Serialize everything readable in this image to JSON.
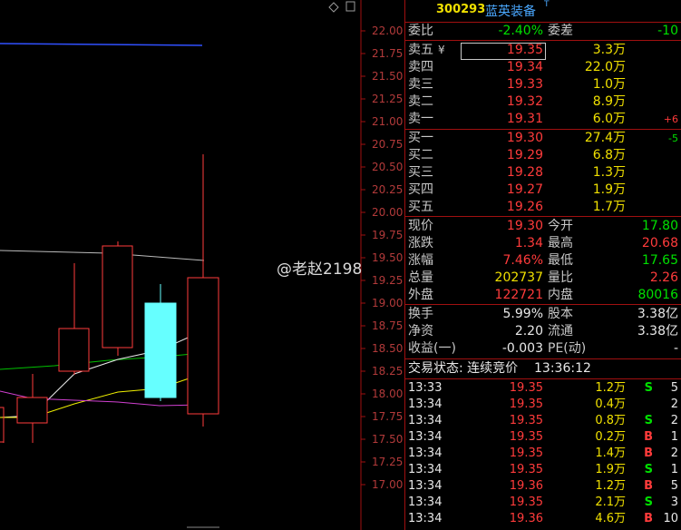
{
  "chart": {
    "price_ticks": [
      "22.00",
      "21.75",
      "21.50",
      "21.25",
      "21.00",
      "20.75",
      "20.50",
      "20.25",
      "20.00",
      "19.75",
      "19.50",
      "19.25",
      "19.00",
      "18.75",
      "18.50",
      "18.25",
      "18.00",
      "17.75",
      "17.50",
      "17.25",
      "17.00"
    ],
    "corner_icon": "diamond-icon"
  },
  "watermark": "@老赵2198",
  "header": {
    "code": "300293",
    "name": "蓝英装备",
    "mark": "T"
  },
  "weibi": {
    "label": "委比",
    "value": "-2.40%",
    "label2": "委差",
    "value2": "-10"
  },
  "sell": [
    {
      "label": "卖五",
      "tag": "¥",
      "price": "19.35",
      "vol": "3.3万",
      "chg": ""
    },
    {
      "label": "卖四",
      "tag": "",
      "price": "19.34",
      "vol": "22.0万",
      "chg": ""
    },
    {
      "label": "卖三",
      "tag": "",
      "price": "19.33",
      "vol": "1.0万",
      "chg": ""
    },
    {
      "label": "卖二",
      "tag": "",
      "price": "19.32",
      "vol": "8.9万",
      "chg": ""
    },
    {
      "label": "卖一",
      "tag": "",
      "price": "19.31",
      "vol": "6.0万",
      "chg": "+6"
    }
  ],
  "buy": [
    {
      "label": "买一",
      "price": "19.30",
      "vol": "27.4万",
      "chg": "-5"
    },
    {
      "label": "买二",
      "price": "19.29",
      "vol": "6.8万",
      "chg": ""
    },
    {
      "label": "买三",
      "price": "19.28",
      "vol": "1.3万",
      "chg": ""
    },
    {
      "label": "买四",
      "price": "19.27",
      "vol": "1.9万",
      "chg": ""
    },
    {
      "label": "买五",
      "price": "19.26",
      "vol": "1.7万",
      "chg": ""
    }
  ],
  "quote": [
    {
      "l1": "现价",
      "v1": "19.30",
      "c1": "red",
      "l2": "今开",
      "v2": "17.80",
      "c2": "grn"
    },
    {
      "l1": "涨跌",
      "v1": "1.34",
      "c1": "red",
      "l2": "最高",
      "v2": "20.68",
      "c2": "red"
    },
    {
      "l1": "涨幅",
      "v1": "7.46%",
      "c1": "red",
      "l2": "最低",
      "v2": "17.65",
      "c2": "grn"
    },
    {
      "l1": "总量",
      "v1": "202737",
      "c1": "yel",
      "l2": "量比",
      "v2": "2.26",
      "c2": "red"
    },
    {
      "l1": "外盘",
      "v1": "122721",
      "c1": "red",
      "l2": "内盘",
      "v2": "80016",
      "c2": "grn"
    }
  ],
  "info": [
    {
      "l1": "换手",
      "v1": "5.99%",
      "l2": "股本",
      "v2": "3.38亿"
    },
    {
      "l1": "净资",
      "v1": "2.20",
      "l2": "流通",
      "v2": "3.38亿"
    },
    {
      "l1": "收益(一)",
      "v1": "-0.003",
      "l2": "PE(动)",
      "v2": "-"
    }
  ],
  "status": {
    "label": "交易状态: 连续竞价",
    "time": "13:36:12"
  },
  "trades": [
    {
      "time": "13:33",
      "price": "19.35",
      "vol": "1.2万",
      "side": "S",
      "n": "5"
    },
    {
      "time": "13:34",
      "price": "19.35",
      "vol": "0.4万",
      "side": "",
      "n": "2"
    },
    {
      "time": "13:34",
      "price": "19.35",
      "vol": "0.8万",
      "side": "S",
      "n": "2"
    },
    {
      "time": "13:34",
      "price": "19.35",
      "vol": "0.2万",
      "side": "B",
      "n": "1"
    },
    {
      "time": "13:34",
      "price": "19.35",
      "vol": "1.4万",
      "side": "B",
      "n": "2"
    },
    {
      "time": "13:34",
      "price": "19.35",
      "vol": "1.9万",
      "side": "S",
      "n": "1"
    },
    {
      "time": "13:34",
      "price": "19.36",
      "vol": "1.2万",
      "side": "B",
      "n": "5"
    },
    {
      "time": "13:34",
      "price": "19.35",
      "vol": "2.1万",
      "side": "S",
      "n": "3"
    },
    {
      "time": "13:34",
      "price": "19.36",
      "vol": "4.6万",
      "side": "B",
      "n": "10"
    }
  ],
  "colors": {
    "up": "#ff3b3b",
    "down": "#00e000",
    "volume": "#f0e000",
    "frame": "#a01010",
    "label": "#c8c8c8",
    "name": "#4aa8ff"
  }
}
